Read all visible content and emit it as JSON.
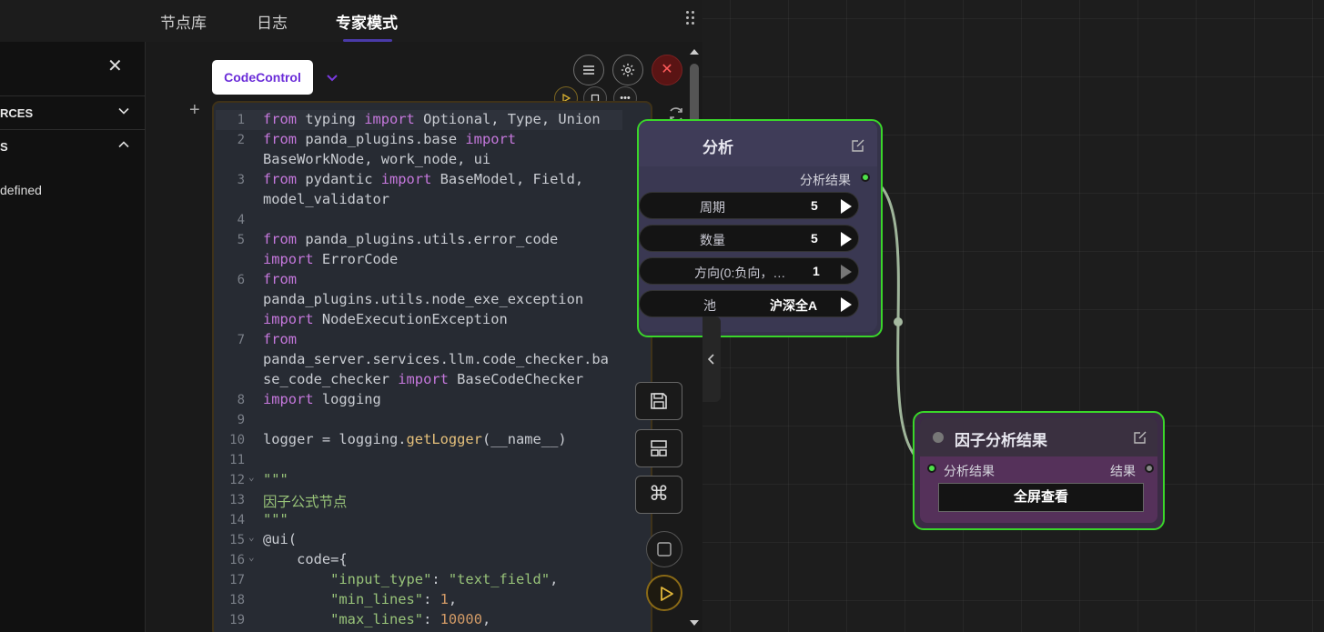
{
  "tabs": [
    {
      "label": "节点库",
      "active": false
    },
    {
      "label": "日志",
      "active": false
    },
    {
      "label": "专家模式",
      "active": true
    }
  ],
  "sidebar": {
    "sections": [
      {
        "label": "RCES",
        "expanded": false
      },
      {
        "label": "S",
        "expanded": true
      }
    ],
    "text": "defined"
  },
  "editor": {
    "node_select": "CodeControl",
    "lines": [
      {
        "num": "1",
        "fold": false,
        "html": "<span class=\"k\">from</span> typing <span class=\"k\">import</span> Optional, Type, Union"
      },
      {
        "num": "2",
        "fold": false,
        "html": "<span class=\"k\">from</span> panda_plugins.base <span class=\"k\">import</span>"
      },
      {
        "num": "",
        "fold": false,
        "html": "BaseWorkNode, work_node, ui"
      },
      {
        "num": "3",
        "fold": false,
        "html": "<span class=\"k\">from</span> pydantic <span class=\"k\">import</span> BaseModel, Field,"
      },
      {
        "num": "",
        "fold": false,
        "html": "model_validator"
      },
      {
        "num": "4",
        "fold": false,
        "html": ""
      },
      {
        "num": "5",
        "fold": false,
        "html": "<span class=\"k\">from</span> panda_plugins.utils.error_code"
      },
      {
        "num": "",
        "fold": false,
        "html": "<span class=\"k\">import</span> ErrorCode"
      },
      {
        "num": "6",
        "fold": false,
        "html": "<span class=\"k\">from</span>"
      },
      {
        "num": "",
        "fold": false,
        "html": "panda_plugins.utils.node_exe_exception"
      },
      {
        "num": "",
        "fold": false,
        "html": "<span class=\"k\">import</span> NodeExecutionException"
      },
      {
        "num": "7",
        "fold": false,
        "html": "<span class=\"k\">from</span>"
      },
      {
        "num": "",
        "fold": false,
        "html": "panda_server.services.llm.code_checker.ba"
      },
      {
        "num": "",
        "fold": false,
        "html": "se_code_checker <span class=\"k\">import</span> BaseCodeChecker"
      },
      {
        "num": "8",
        "fold": false,
        "html": "<span class=\"k\">import</span> logging"
      },
      {
        "num": "9",
        "fold": false,
        "html": ""
      },
      {
        "num": "10",
        "fold": false,
        "html": "logger = logging.<span class=\"f\">getLogger</span>(__name__)"
      },
      {
        "num": "11",
        "fold": false,
        "html": ""
      },
      {
        "num": "12",
        "fold": true,
        "html": "<span class=\"s\">\"\"\"</span>"
      },
      {
        "num": "13",
        "fold": false,
        "html": "<span class=\"s\">因子公式节点</span>"
      },
      {
        "num": "14",
        "fold": false,
        "html": "<span class=\"s\">\"\"\"</span>"
      },
      {
        "num": "15",
        "fold": true,
        "html": "@ui("
      },
      {
        "num": "16",
        "fold": true,
        "html": "    code={"
      },
      {
        "num": "17",
        "fold": false,
        "html": "        <span class=\"s\">\"input_type\"</span>: <span class=\"s\">\"text_field\"</span>,"
      },
      {
        "num": "18",
        "fold": false,
        "html": "        <span class=\"s\">\"min_lines\"</span>: <span class=\"n\">1</span>,"
      },
      {
        "num": "19",
        "fold": false,
        "html": "        <span class=\"s\">\"max_lines\"</span>: <span class=\"n\">10000</span>,"
      }
    ]
  },
  "node1": {
    "title": "分析",
    "output_label": "分析结果",
    "params": [
      {
        "label": "周期",
        "value": "5"
      },
      {
        "label": "数量",
        "value": "5"
      },
      {
        "label": "方向(0:负向，…",
        "value": "1"
      },
      {
        "label": "池",
        "value": "沪深全A"
      }
    ]
  },
  "node2": {
    "title": "因子分析结果",
    "input_label": "分析结果",
    "output_label": "结果",
    "button": "全屏查看"
  },
  "colors": {
    "node_border": "#3ad62a",
    "keyword": "#c678dd",
    "string": "#98c379",
    "number": "#d19a66",
    "accent_purple": "#6a2cd8"
  }
}
